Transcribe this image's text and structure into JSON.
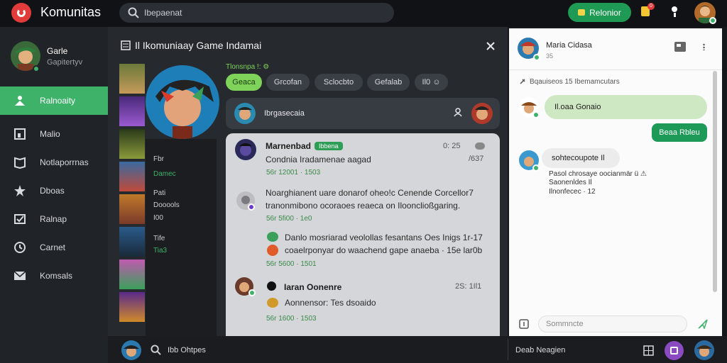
{
  "app": {
    "title": "Komunitas"
  },
  "search": {
    "placeholder": "Ibepaenat"
  },
  "header": {
    "button_label": "Relonior",
    "notif_count": "0"
  },
  "sidebar": {
    "profile": {
      "name": "Garle",
      "subtitle": "Gapitertyv"
    },
    "items": [
      {
        "label": "Ralnoaity",
        "icon": "community-icon",
        "active": true
      },
      {
        "label": "Malio",
        "icon": "frame-icon",
        "active": false
      },
      {
        "label": "Notlaporrnas",
        "icon": "book-icon",
        "active": false
      },
      {
        "label": "Dboas",
        "icon": "star-icon",
        "active": false
      },
      {
        "label": "Ralnap",
        "icon": "send-icon",
        "active": false
      },
      {
        "label": "Carnet",
        "icon": "clock-icon",
        "active": false
      },
      {
        "label": "Komsals",
        "icon": "mail-icon",
        "active": false
      }
    ]
  },
  "main": {
    "title": "Il Ikomuniaay Game Indamai",
    "sublabel": "Tlonsnpa !: ⚙",
    "chips": [
      "Geaca",
      "Grcofan",
      "Sclocbto",
      "Gefalab",
      "Il0 ☺"
    ],
    "profile_col": [
      {
        "text": "Fbr",
        "green": false
      },
      {
        "text": "Damec",
        "green": true
      },
      {
        "text": "Pati",
        "green": false
      },
      {
        "text": "Dooools",
        "green": false
      },
      {
        "text": "I00",
        "green": false
      },
      {
        "text": "Tife",
        "green": false
      },
      {
        "text": "Tia3",
        "green": true
      }
    ],
    "thread_title": "Ibrgasecaia",
    "posts": [
      {
        "name": "Marnenbad",
        "badge": "Ibbena",
        "time": "0: 25",
        "text": "Condnia Iradamenae aagad",
        "time2": "/637",
        "meta": "56r 12001 · 1503"
      },
      {
        "name": "",
        "badge": "",
        "time": "",
        "text": "Noarghianent uare donarof oheo!c Cenende Corcellor7",
        "text2": "tranonmibono ocoraoes reaeca on Iloonclioßgaring.",
        "meta": "56r 5fi00 · 1e0"
      },
      {
        "name": "",
        "badge": "",
        "time": "",
        "text": "Danlo mosriarad veolollas fesantans Oes Inigs 1r-17",
        "text2": "coaelrponyar do waachend gape anaeba · 15e lar0b",
        "meta": "56r 5600 · 1501"
      },
      {
        "name": "Iaran Oonenre",
        "badge": "",
        "time": "2S: 1Il1",
        "text": "Aonnensor: Tes dsoaido",
        "meta": "56r 1600 · 1503"
      }
    ]
  },
  "chat": {
    "name": "Maria Cidasa",
    "sub": "35",
    "note": "Bqauiseos 15 Ibemamcutars",
    "msg_in": "Il.oaa Gonaio",
    "msg_out": "Beaa Rbleu",
    "msg_gray": "sohtecoupote Il",
    "msg_detail_1": "Pasol chrosaye oocianmär ü ⚠",
    "msg_detail_2": "Saonenldes Il",
    "msg_detail_3": "Ilnonfecec · 12",
    "input_placeholder": "Sommncte"
  },
  "bottombar": {
    "search_text": "Ibb Ohtpes",
    "right_text": "Deab Neagien"
  },
  "colors": {
    "accent": "#3fb26a",
    "brand_red": "#e23b3b",
    "dark_bg": "#15171b",
    "green_button": "#1f9a54"
  }
}
